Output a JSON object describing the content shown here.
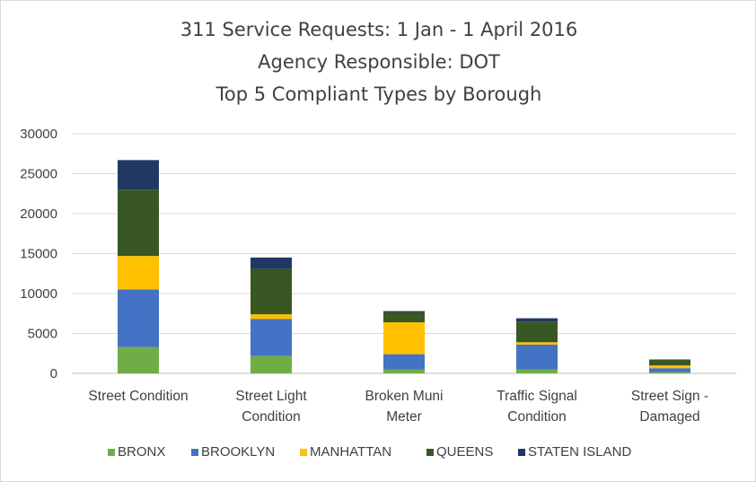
{
  "chart_data": {
    "type": "bar",
    "stacked": true,
    "title_lines": [
      "311 Service Requests: 1 Jan - 1 April 2016",
      "Agency Responsible: DOT",
      "Top 5 Compliant Types by Borough"
    ],
    "categories": [
      [
        "Street Condition"
      ],
      [
        "Street Light",
        "Condition"
      ],
      [
        "Broken Muni",
        "Meter"
      ],
      [
        "Traffic Signal",
        "Condition"
      ],
      [
        "Street Sign -",
        "Damaged"
      ]
    ],
    "series": [
      {
        "name": "BRONX",
        "color": "#70ad47",
        "values": [
          3300,
          2200,
          500,
          500,
          150
        ]
      },
      {
        "name": "BROOKLYN",
        "color": "#4472c4",
        "values": [
          7200,
          4600,
          1900,
          3100,
          500
        ]
      },
      {
        "name": "MANHATTAN",
        "color": "#ffc000",
        "values": [
          4200,
          600,
          4000,
          300,
          350
        ]
      },
      {
        "name": "QUEENS",
        "color": "#385723",
        "values": [
          8300,
          5700,
          1300,
          2600,
          700
        ]
      },
      {
        "name": "STATEN ISLAND",
        "color": "#203864",
        "values": [
          3700,
          1400,
          100,
          400,
          50
        ]
      }
    ],
    "ylim": [
      0,
      30000
    ],
    "yticks": [
      "0",
      "5000",
      "10000",
      "15000",
      "20000",
      "25000",
      "30000"
    ],
    "grid": true,
    "legend_position": "bottom",
    "xlabel": "",
    "ylabel": ""
  }
}
